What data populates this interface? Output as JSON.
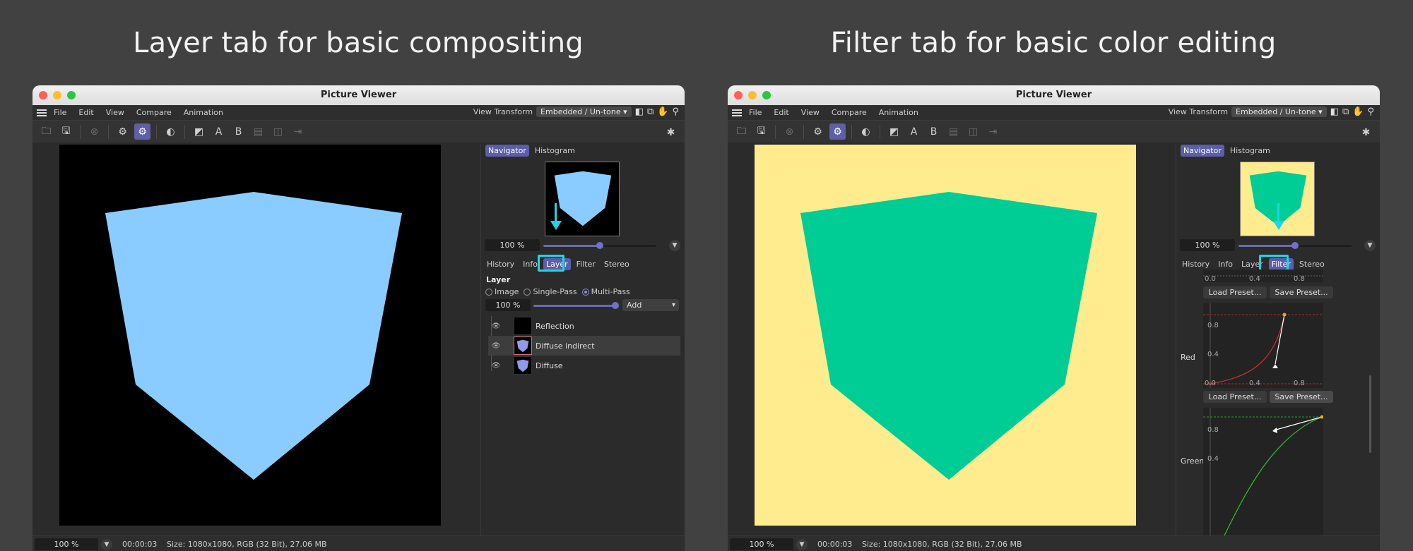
{
  "headings": {
    "left": "Layer tab for basic compositing",
    "right": "Filter tab for basic color editing"
  },
  "window": {
    "title": "Picture Viewer",
    "menu": [
      "File",
      "Edit",
      "View",
      "Compare",
      "Animation"
    ],
    "view_transform_label": "View Transform",
    "view_transform_value": "Embedded / Un-tone",
    "navigator_tabs": [
      "Navigator",
      "Histogram"
    ],
    "navigator_zoom": "100 %",
    "navigator_zoom_level": 0.5,
    "inspector_tabs": [
      "History",
      "Info",
      "Layer",
      "Filter",
      "Stereo"
    ],
    "status": {
      "zoom": "100 %",
      "timecode": "00:00:03",
      "info": "Size: 1080x1080, RGB (32 Bit), 27.06 MB"
    }
  },
  "left_panel": {
    "active_tab": "Layer",
    "image_bg": "#000000",
    "cube_color": "#8accff",
    "layer": {
      "title": "Layer",
      "modes": [
        "Image",
        "Single-Pass",
        "Multi-Pass"
      ],
      "selected_mode": "Multi-Pass",
      "opacity": "100 %",
      "opacity_level": 1.0,
      "blend": "Add",
      "layers": [
        {
          "name": "Reflection",
          "visible": true,
          "selected": false,
          "has_thumb_shape": false
        },
        {
          "name": "Diffuse indirect",
          "visible": true,
          "selected": true,
          "has_thumb_shape": true
        },
        {
          "name": "Diffuse",
          "visible": true,
          "selected": false,
          "has_thumb_shape": true
        }
      ]
    }
  },
  "right_panel": {
    "active_tab": "Filter",
    "image_bg": "#ffec8f",
    "cube_color": "#00cc96",
    "filter": {
      "load_label": "Load Preset...",
      "save_label": "Save Preset...",
      "tick_labels": [
        "0.0",
        "0.4",
        "0.8"
      ],
      "y_tick_labels": [
        "0.8",
        "0.4"
      ],
      "channels": [
        {
          "name": "Red",
          "curve_color": "#d03030"
        },
        {
          "name": "Green",
          "curve_color": "#30c030"
        }
      ]
    }
  },
  "colors": {
    "accent": "#5c5ea8",
    "annotation": "#1ed5e5"
  }
}
